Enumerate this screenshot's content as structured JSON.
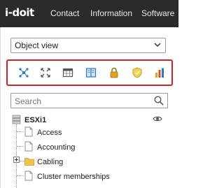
{
  "header": {
    "logo_text": "i-doit",
    "nav": [
      {
        "label": "Contact"
      },
      {
        "label": "Information"
      },
      {
        "label": "Software"
      }
    ]
  },
  "sidebar": {
    "view_select": {
      "value": "Object view",
      "icon": "chevron-down-icon"
    },
    "toolbar": {
      "highlight_color": "#d61f26",
      "icons": [
        {
          "name": "network-nodes-icon",
          "color": "#2a78c2"
        },
        {
          "name": "expand-arrows-icon",
          "color": "#555555"
        },
        {
          "name": "calendar-table-icon",
          "color": "#555555"
        },
        {
          "name": "book-icon",
          "color": "#2a78c2"
        },
        {
          "name": "lock-icon",
          "color": "#e0a31a"
        },
        {
          "name": "shield-icon",
          "color": "#e0c01a"
        },
        {
          "name": "bar-chart-icon",
          "color": "#e04a1a"
        }
      ]
    },
    "search": {
      "placeholder": "Search",
      "icon": "search-icon"
    },
    "tree": {
      "root": {
        "label": "ESXi1",
        "icon": "server-icon"
      },
      "visibility_icon": "eye-icon",
      "items": [
        {
          "label": "Access",
          "icon": "page-icon"
        },
        {
          "label": "Accounting",
          "icon": "page-icon"
        },
        {
          "label": "Cabling",
          "icon": "folder-icon",
          "expandable": true
        },
        {
          "label": "Cluster memberships",
          "icon": "page-icon"
        }
      ]
    }
  }
}
